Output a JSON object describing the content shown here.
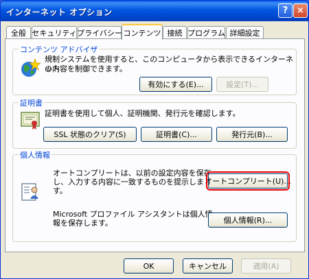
{
  "window": {
    "title": "インターネット オプション",
    "help": "?",
    "close": "×"
  },
  "tabs": [
    "全般",
    "セキュリティ",
    "プライバシー",
    "コンテンツ",
    "接続",
    "プログラム",
    "詳細設定"
  ],
  "content_advisor": {
    "label": "コンテンツ アドバイザ",
    "desc1": "規制システムを使用すると、このコンピュータから表示できるインターネット",
    "desc2": "の内容を制御できます。",
    "enable": "有効にする(E)...",
    "settings": "設定(T)..."
  },
  "certificates": {
    "label": "証明書",
    "desc": "証明書を使用して個人、証明機関、発行元を確認します。",
    "clear_ssl": "SSL 状態のクリア(S)",
    "certs": "証明書(C)...",
    "publishers": "発行元(B)..."
  },
  "personal": {
    "label": "個人情報",
    "auto_desc1": "オートコンプリートは、以前の設定内容を保存",
    "auto_desc2": "し、入力する内容に一致するものを提示しま",
    "auto_desc3": "す。",
    "autocomplete": "オートコンプリート(U)...",
    "profile_desc1": "Microsoft プロファイル アシスタントは個人情",
    "profile_desc2": "報を保存します。",
    "my_profile": "個人情報(R)..."
  },
  "footer": {
    "ok": "OK",
    "cancel": "キャンセル",
    "apply": "適用(A)"
  },
  "colors": {
    "titlebar": "#0054e3",
    "group_label": "#0046d5",
    "highlight": "#e60000"
  }
}
